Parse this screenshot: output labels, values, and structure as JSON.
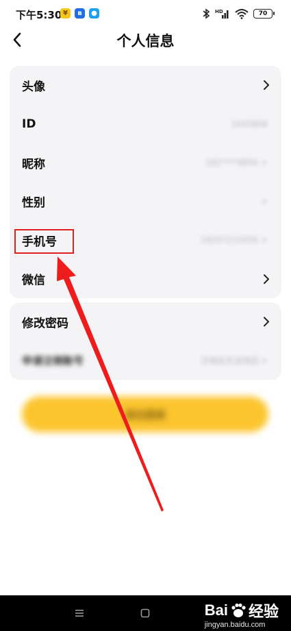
{
  "status_bar": {
    "time": "下午5:30",
    "battery": "70",
    "signal_label": "HD"
  },
  "header": {
    "title": "个人信息"
  },
  "profile_card": {
    "rows": [
      {
        "label": "头像",
        "value": "",
        "has_chevron": true
      },
      {
        "label": "ID",
        "value": "1645808",
        "has_chevron": false
      },
      {
        "label": "昵称",
        "value": "182****8856 >",
        "has_chevron": false
      },
      {
        "label": "性别",
        "value": ">",
        "has_chevron": false
      },
      {
        "label": "手机号",
        "value": "18207233056 >",
        "has_chevron": false
      },
      {
        "label": "微信",
        "value": "",
        "has_chevron": true
      }
    ]
  },
  "security_card": {
    "rows": [
      {
        "label": "修改密码",
        "value": "",
        "has_chevron": true
      },
      {
        "label": "申请注销账号",
        "value": "注销后无法找回 >",
        "has_chevron": false
      }
    ]
  },
  "logout_button": {
    "label": "退出登录"
  },
  "watermark": {
    "brand": "Bai",
    "brand_suffix": "经验",
    "url": "jingyan.baidu.com"
  },
  "colors": {
    "accent_yellow": "#fcc52e",
    "highlight_red": "#e0201e",
    "card_bg": "#f4f4f6"
  }
}
